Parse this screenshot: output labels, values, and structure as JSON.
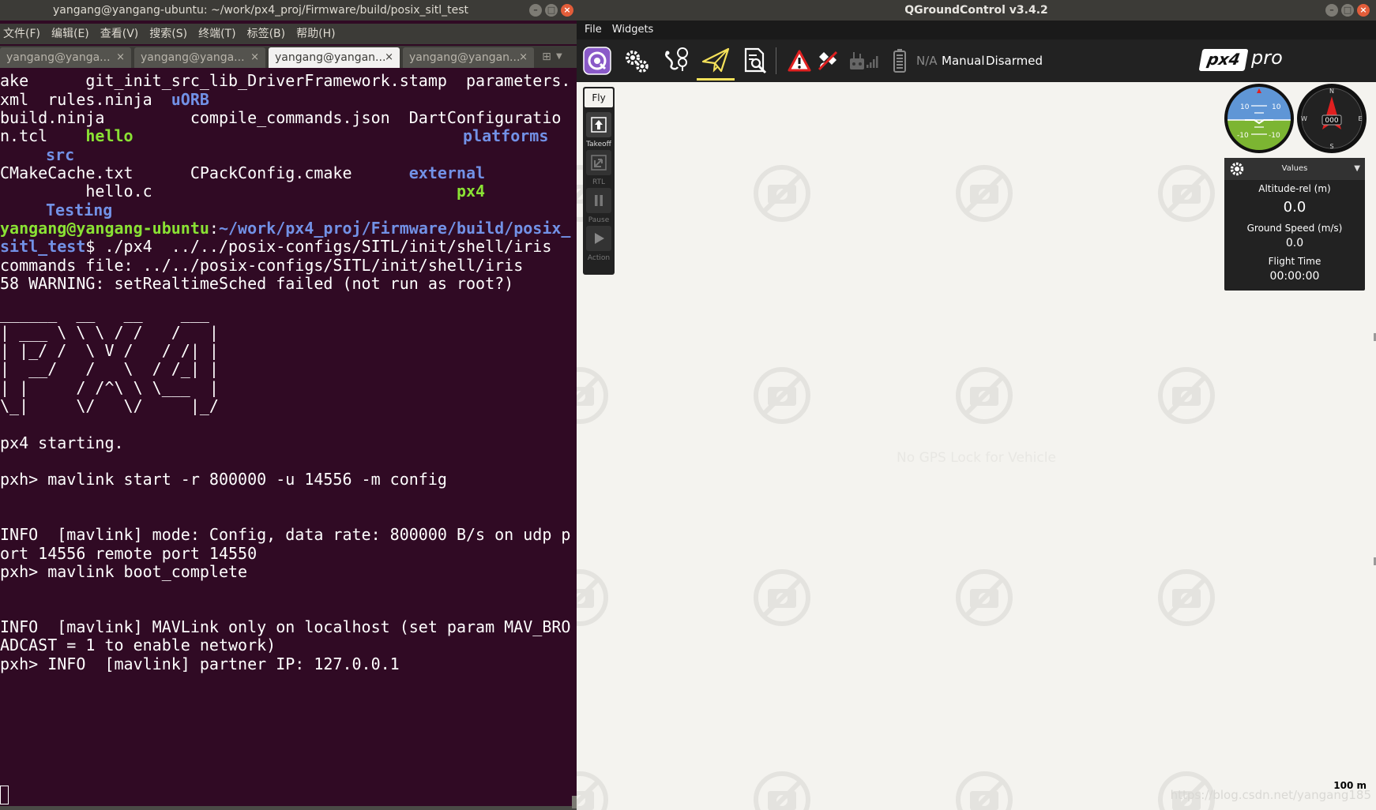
{
  "terminal": {
    "title": "yangang@yangang-ubuntu: ~/work/px4_proj/Firmware/build/posix_sitl_test",
    "menu": [
      "文件(F)",
      "编辑(E)",
      "查看(V)",
      "搜索(S)",
      "终端(T)",
      "标签(B)",
      "帮助(H)"
    ],
    "tabs": [
      "yangang@yanga...",
      "yangang@yanga...",
      "yangang@yangan...",
      "yangang@yangan..."
    ],
    "active_tab": 2,
    "lines": {
      "l1a": "ake      git_init_src_lib_DriverFramework.stamp  parameters.",
      "l2a": "xml  rules.ninja  ",
      "l2b": "uORB",
      "l3a": "build.ninja         compile_commands.json  DartConfiguratio",
      "l4a": "n.tcl    ",
      "l4b": "hello",
      "l4c": "platforms",
      "l5b": "src",
      "l6a": "CMakeCache.txt      CPackConfig.cmake      ",
      "l6b": "external",
      "l7a": "         hello.c                                ",
      "l7b": "px4",
      "l8b": "Testing",
      "l9a": "yangang@yangang-ubuntu",
      "l9b": ":",
      "l9c": "~/work/px4_proj/Firmware/build/posix_",
      "l10a": "sitl_test",
      "l10b": "$ ./px4  ../../posix-configs/SITL/init/shell/iris",
      "l11": "commands file: ../../posix-configs/SITL/init/shell/iris",
      "l12": "58 WARNING: setRealtimeSched failed (not run as root?)",
      "ascii1": "______  __   __    ___ ",
      "ascii2": "| ___ \\ \\ \\ / /   /   |",
      "ascii3": "| |_/ /  \\ V /   / /| |",
      "ascii4": "|  __/   /   \\  / /_| |",
      "ascii5": "| |     / /^\\ \\ \\___  |",
      "ascii6": "\\_|     \\/   \\/     |_/",
      "l13": "px4 starting.",
      "l14": "pxh> mavlink start -r 800000 -u 14556 -m config",
      "l15": "INFO  [mavlink] mode: Config, data rate: 800000 B/s on udp p",
      "l16": "ort 14556 remote port 14550",
      "l17": "pxh> mavlink boot_complete",
      "l18": "INFO  [mavlink] MAVLink only on localhost (set param MAV_BRO",
      "l19": "ADCAST = 1 to enable network)",
      "l20": "pxh> INFO  [mavlink] partner IP: 127.0.0.1"
    }
  },
  "qgc": {
    "title": "QGroundControl v3.4.2",
    "menu": [
      "File",
      "Widgets"
    ],
    "toolbar": {
      "battery": "N/A",
      "flight_mode": "Manual",
      "arm_state": "Disarmed",
      "brand": "px4",
      "brand_sub": "pro"
    },
    "fly_tools": {
      "title": "Fly",
      "takeoff": "Takeoff",
      "rtl": "RTL",
      "pause": "Pause",
      "action": "Action"
    },
    "instruments": {
      "pitch_up": "10",
      "pitch_down": "-10",
      "heading": "000",
      "compass_n": "N",
      "compass_e": "E",
      "compass_s": "S",
      "compass_w": "W"
    },
    "values": {
      "header": "Values",
      "altitude_label": "Altitude-rel (m)",
      "altitude_value": "0.0",
      "speed_label": "Ground Speed (m/s)",
      "speed_value": "0.0",
      "time_label": "Flight Time",
      "time_value": "00:00:00"
    },
    "map": {
      "no_gps": "No GPS Lock for Vehicle",
      "scale": "100 m",
      "watermark": "https://blog.csdn.net/yangang185"
    },
    "colors": {
      "terminal_bg": "#300a24",
      "dir_blue": "#7291e6",
      "exec_green": "#8ae234",
      "active_underline": "#f5e15a"
    }
  }
}
